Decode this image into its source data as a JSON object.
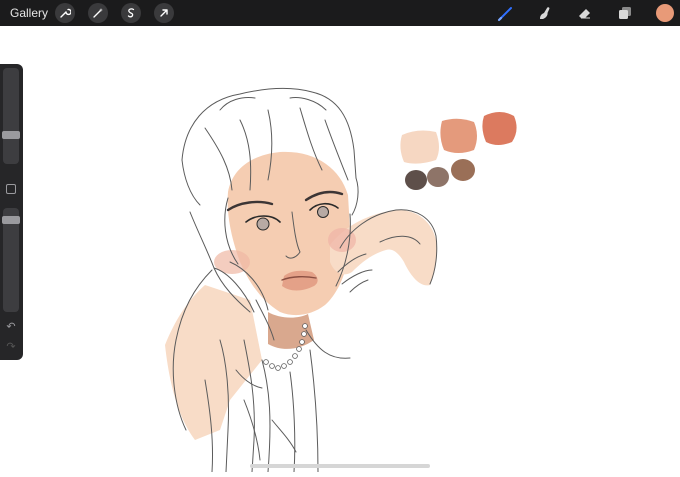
{
  "topbar": {
    "gallery_label": "Gallery",
    "left_tools": [
      "wrench-icon",
      "magic-wand-icon",
      "selection-icon",
      "transform-arrow-icon"
    ],
    "right_tools": [
      "brush-icon",
      "smudge-icon",
      "eraser-icon",
      "layers-icon"
    ],
    "current_color": "#e89a78"
  },
  "colors": {
    "topbar_bg": "#1b1b1c",
    "brush_active": "#2f6fff",
    "palette": [
      "#f6d7c2",
      "#e49a7c",
      "#dc7a5f",
      "#5e4f4a",
      "#8e7468",
      "#9a6f57"
    ]
  },
  "sidebar": {
    "brush_size_level": 0.72,
    "opacity_level": 0.08
  }
}
